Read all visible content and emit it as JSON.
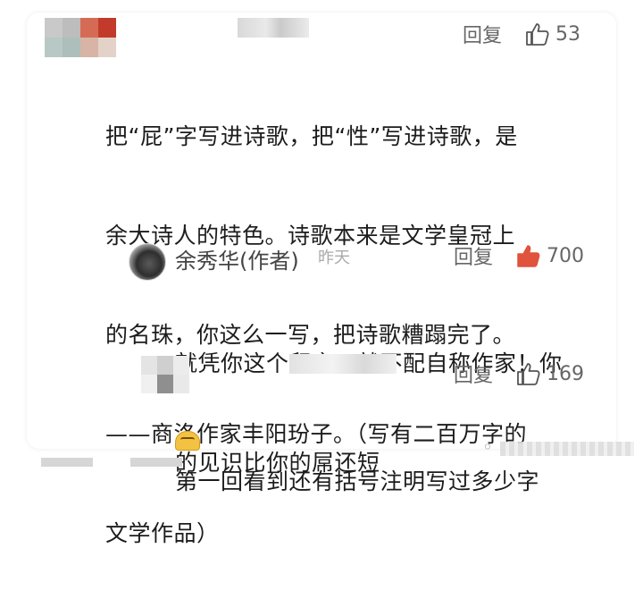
{
  "comment": {
    "reply_label": "回复",
    "like_count": "53",
    "lines": [
      "把“屁”字写进诗歌，把“性”写进诗歌，是",
      "余大诗人的特色。诗歌本来是文学皇冠上",
      "的名珠，你这么一写，把诗歌糟蹋完了。",
      "——商洛作家丰阳玢子。（写有二百万字的",
      "文学作品）"
    ]
  },
  "reply_author": {
    "name": "余秀华(作者)",
    "time": "昨天",
    "reply_label": "回复",
    "like_count": "700",
    "lines": [
      "就凭你这个留言，就不配自称作家！你",
      "的见识比你的屌还短"
    ],
    "like_color": "#e0533c"
  },
  "reply_other": {
    "reply_label": "回复",
    "like_count": "169",
    "lines": [
      "第一回看到还有括号注明写过多少字"
    ]
  },
  "icons": {
    "thumb": "thumbs-up-icon",
    "avatar_mosaic": "mosaic-avatar"
  }
}
